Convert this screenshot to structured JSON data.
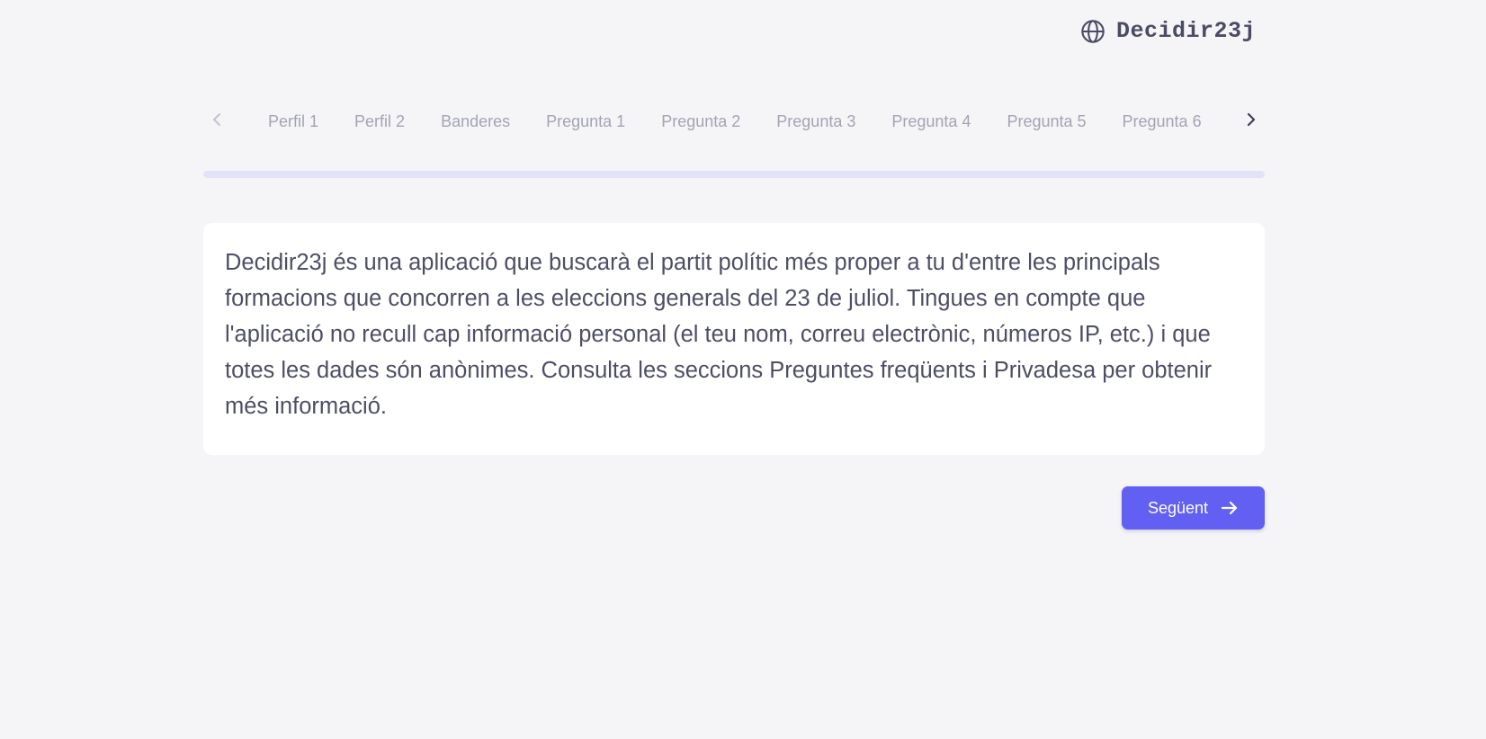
{
  "header": {
    "brand_name": "Decidir23j",
    "brand_icon": "globe-icon"
  },
  "steps": {
    "prev_icon": "chevron-left-icon",
    "next_icon": "chevron-right-icon",
    "tabs": [
      {
        "label": "Perfil 1"
      },
      {
        "label": "Perfil 2"
      },
      {
        "label": "Banderes"
      },
      {
        "label": "Pregunta 1"
      },
      {
        "label": "Pregunta 2"
      },
      {
        "label": "Pregunta 3"
      },
      {
        "label": "Pregunta 4"
      },
      {
        "label": "Pregunta 5"
      },
      {
        "label": "Pregunta 6"
      }
    ]
  },
  "progress": {
    "value": 0,
    "track_color": "#e3e3f7"
  },
  "intro": {
    "text": "Decidir23j és una aplicació que buscarà el partit polític més proper a tu d'entre les principals formacions que concorren a les eleccions generals del 23 de juliol. Tingues en compte que l'aplicació no recull cap informació personal (el teu nom, correu electrònic, números IP, etc.) i que totes les dades són anònimes. Consulta les seccions Preguntes freqüents i Privadesa per obtenir més informació."
  },
  "actions": {
    "next_label": "Següent",
    "next_icon": "arrow-right-icon",
    "accent_color": "#6160f2"
  }
}
